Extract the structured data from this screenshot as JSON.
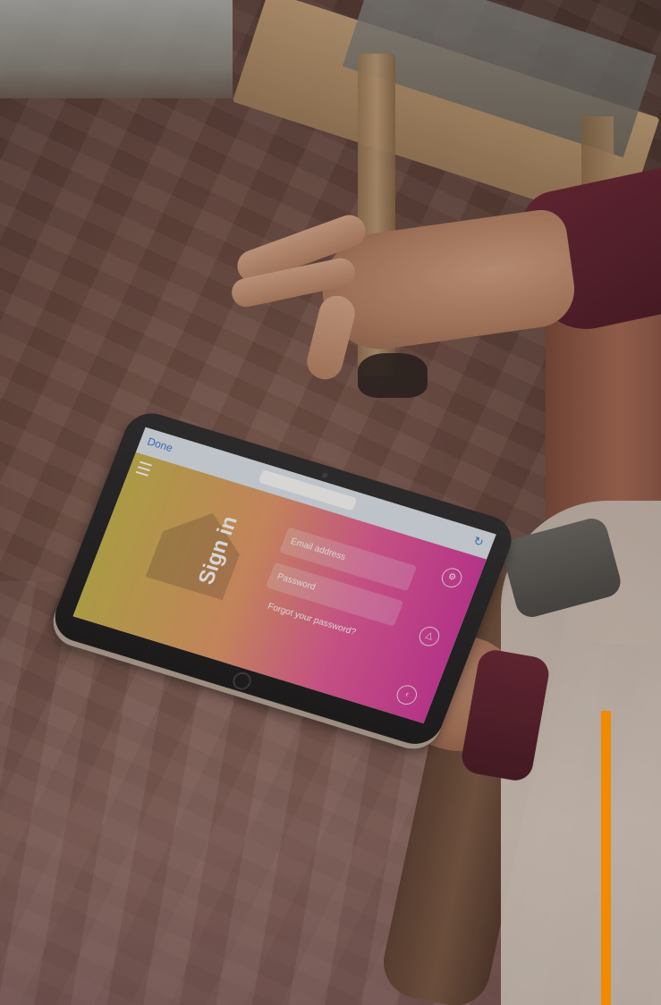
{
  "photo": {
    "subject": "hands-holding-tablet"
  },
  "tablet_screen": {
    "nav": {
      "done_label": "Done",
      "url_text": "",
      "reload_icon": "reload-icon"
    },
    "app": {
      "title": "Sign in",
      "email_placeholder": "Email address",
      "password_placeholder": "Password",
      "forgot_link": "Forgot your password?",
      "menu_icon": "menu-icon"
    },
    "gradient_colors": [
      "#c8b64e",
      "#e59a6a",
      "#e75c9c",
      "#d43aa0"
    ]
  },
  "accent": {
    "color": "#f08a00"
  }
}
